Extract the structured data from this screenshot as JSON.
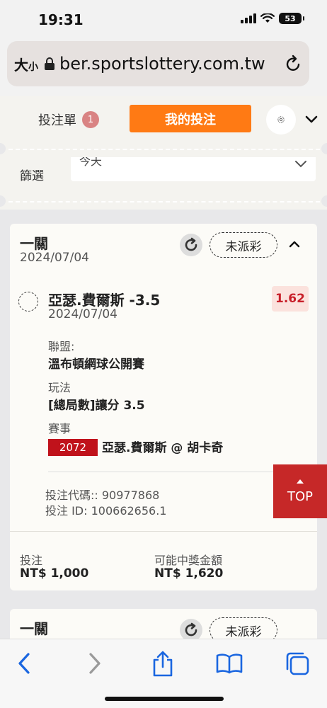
{
  "status_bar": {
    "time": "19:31",
    "battery": "53"
  },
  "browser": {
    "text_size_label": "大",
    "text_size_small": "小",
    "url": "ber.sportslottery.com.tw"
  },
  "header": {
    "slip_label": "投注單",
    "slip_count": "1",
    "my_bets_label": "我的投注"
  },
  "filter": {
    "label": "篩選",
    "value": "今天"
  },
  "bets": [
    {
      "title": "一關",
      "date": "2024/07/04",
      "status": "未派彩",
      "selection": {
        "name": "亞瑟.費爾斯 -3.5",
        "date": "2024/07/04",
        "odds": "1.62"
      },
      "league_label": "聯盟:",
      "league": "溫布頓網球公開賽",
      "market_label": "玩法",
      "market": "[總局數]讓分 3.5",
      "event_label": "賽事",
      "event_id": "2072",
      "event_name": "亞瑟.費爾斯 @ 胡卡奇",
      "bet_code": "投注代碼:: 90977868",
      "bet_id": "投注 ID: 100662656.1",
      "stake_label": "投注",
      "stake": "NT$ 1,000",
      "win_label": "可能中獎金額",
      "win": "NT$ 1,620"
    },
    {
      "title": "一關",
      "status": "未派彩"
    }
  ],
  "top_button": "TOP",
  "colors": {
    "accent": "#ff7a14",
    "red": "#c62828",
    "odds_bg": "#fbe2dd"
  }
}
